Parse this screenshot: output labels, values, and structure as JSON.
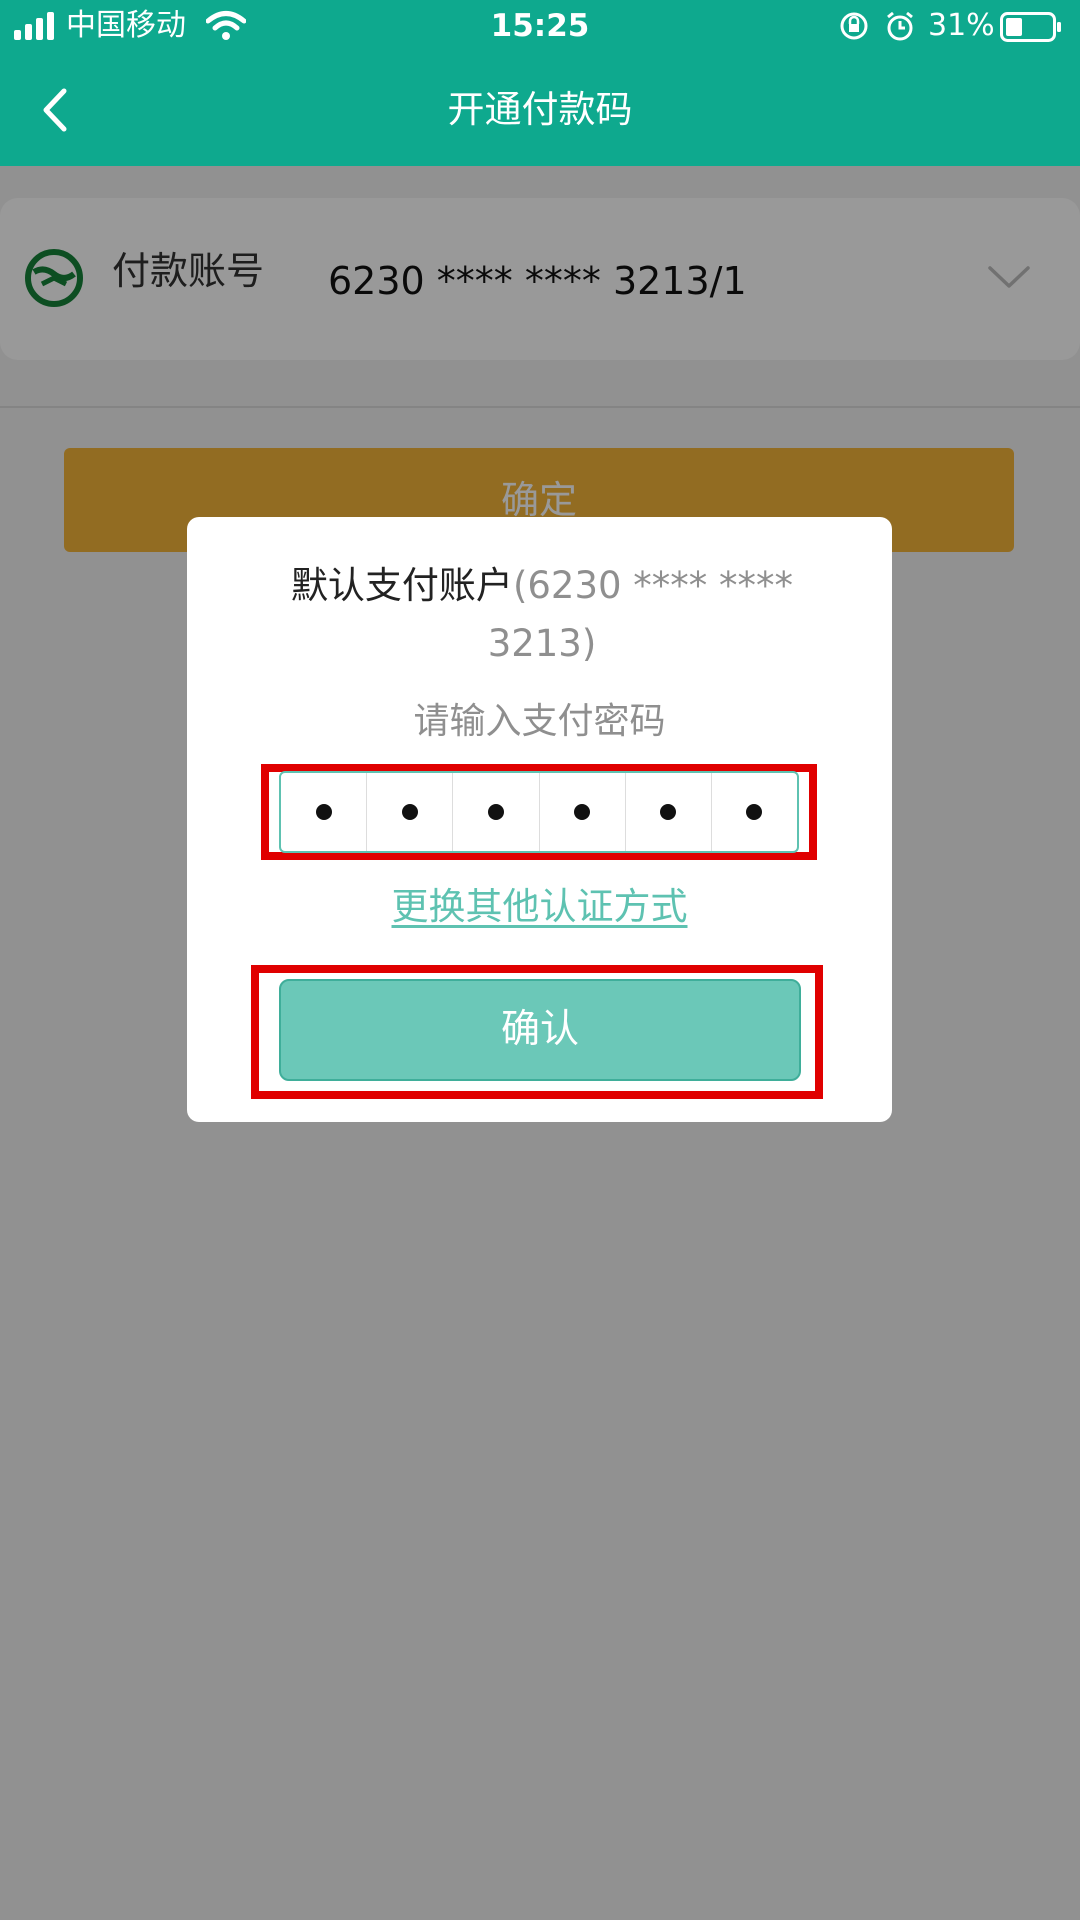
{
  "status_bar": {
    "carrier": "中国移动",
    "time": "15:25",
    "battery": "31%"
  },
  "nav": {
    "title": "开通付款码"
  },
  "account": {
    "label": "付款账号",
    "number": "6230 **** **** 3213/1"
  },
  "main_button": {
    "label": "确定"
  },
  "modal": {
    "title_label": "默认支付账户",
    "title_account": "(6230 **** **** 3213)",
    "prompt": "请输入支付密码",
    "password_digits": 6,
    "switch_link": "更换其他认证方式",
    "confirm_label": "确认"
  },
  "colors": {
    "brand": "#0ea98e",
    "accent_button": "#f3b43a",
    "modal_button": "#6bc8b8",
    "highlight_frame": "#e00000"
  }
}
